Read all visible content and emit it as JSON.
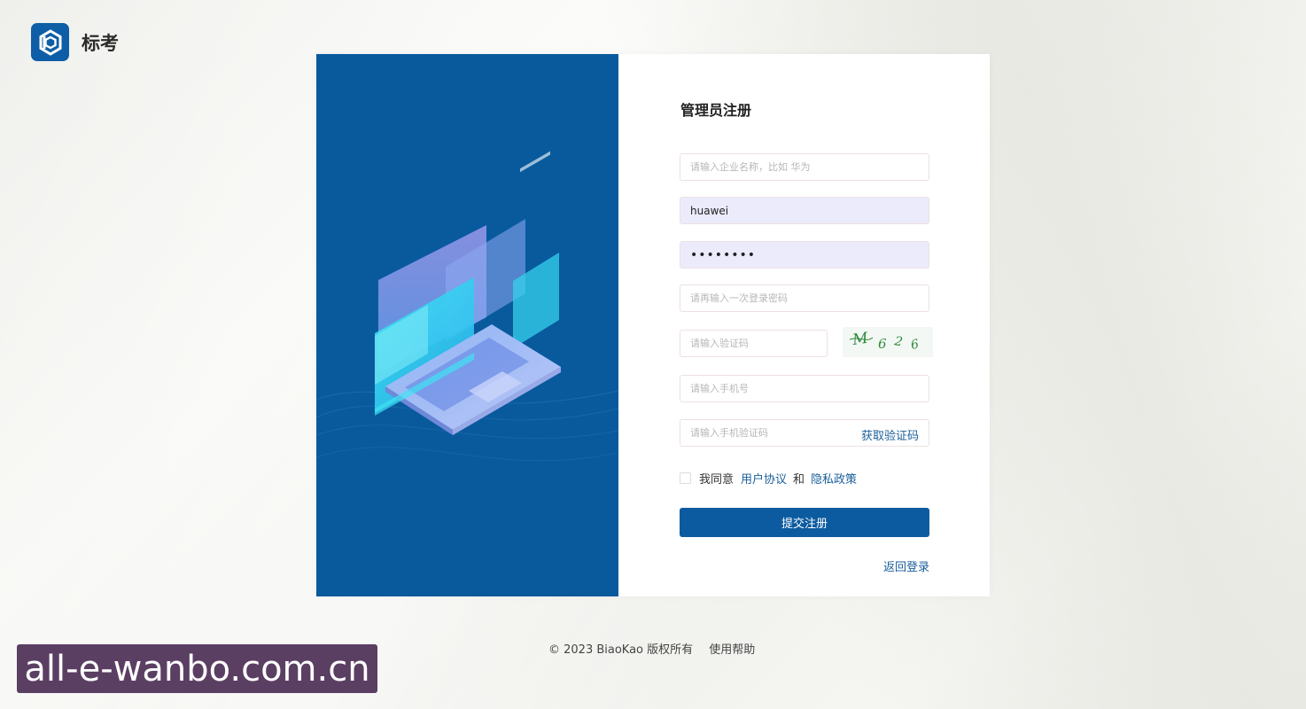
{
  "brand": {
    "name": "标考",
    "icon": "hexagon-logo-icon",
    "color": "#0d5ea6"
  },
  "form": {
    "title": "管理员注册",
    "company": {
      "placeholder": "请输入企业名称，比如 华为",
      "value": ""
    },
    "username": {
      "value": "huawei"
    },
    "password": {
      "value": "••••••••"
    },
    "confirm_password": {
      "placeholder": "请再输入一次登录密码",
      "value": ""
    },
    "captcha": {
      "placeholder": "请输入验证码",
      "value": "",
      "image_text": "M626"
    },
    "phone": {
      "placeholder": "请输入手机号",
      "value": ""
    },
    "sms_code": {
      "placeholder": "请输入手机验证码",
      "value": "",
      "get_code_label": "获取验证码"
    },
    "agreement": {
      "checked": false,
      "prefix": "我同意",
      "user_agreement": "用户协议",
      "and": "和",
      "privacy_policy": "隐私政策"
    },
    "submit_label": "提交注册",
    "back_to_login": "返回登录"
  },
  "footer": {
    "copyright": "© 2023 BiaoKao 版权所有",
    "help": "使用帮助"
  },
  "watermark": {
    "text": "all-e-wanbo.com.cn"
  },
  "colors": {
    "primary": "#0c5ba0",
    "link": "#1b5f9a",
    "illustration_bg": "#085a9d"
  }
}
